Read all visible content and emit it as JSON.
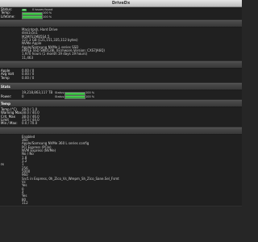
{
  "window": {
    "title": "DriveDx"
  },
  "summary": {
    "rows": [
      {
        "label": "Status:",
        "badge": "OK",
        "value": "0 issues found"
      },
      {
        "label": "Temp:",
        "bar_value": "100 %",
        "bar_fill": 1.0
      },
      {
        "label": "Lifetime:",
        "bar_value": "100 %",
        "bar_fill": 1.0
      }
    ]
  },
  "info": {
    "rows": [
      {
        "label": "",
        "value": "Macintosh, Hard Drive"
      },
      {
        "label": "",
        "value": "disk1s5s1"
      },
      {
        "label": "",
        "value": "M2MFS1MB5S4.5"
      },
      {
        "label": "",
        "value": "121.3 GB (121,151,335,112 bytes)"
      },
      {
        "label": "",
        "value": "NVMe Apple"
      },
      {
        "label": "",
        "value": "Apple/Samsung NVMe L series SSD"
      },
      {
        "label": "",
        "value": "APPLE SSD SM0128L (Firmware Version: CXS7JA6Q)"
      },
      {
        "label": "",
        "value": "1,970 hours (1 month 19 days 19 hours)"
      },
      {
        "label": "",
        "value": "11,463"
      }
    ]
  },
  "power": {
    "rows": [
      {
        "label": "Apple",
        "value": "0.00 / 0"
      },
      {
        "label": "Avg Volt",
        "value": "0.00 / 0"
      },
      {
        "label": "Temp",
        "value": "0.00 / 0"
      }
    ]
  },
  "stats": {
    "header": "Stats",
    "rows": [
      {
        "label": "",
        "value": "19,218,863,117 TB",
        "status": "Status:",
        "bar_value": "100 %",
        "bar_fill": 1.0
      },
      {
        "label": "Power:",
        "value": "0",
        "status": "Status:",
        "bar_value": "100 %",
        "bar_fill": 1.0
      }
    ]
  },
  "temps": {
    "header": "Temp",
    "rows": [
      {
        "label": "Temp (°C)",
        "value": "39.0 / 1.0"
      },
      {
        "label": "Warning Max",
        "value": "38.0 / 40.0"
      },
      {
        "label": "Crit. Max",
        "value": "38.0 / 46.0"
      },
      {
        "label": "Limit",
        "value": "13.0 / 44.0"
      },
      {
        "label": "Min / Max:",
        "value": "0.0 / 70.0"
      }
    ]
  },
  "details": {
    "rows": [
      {
        "label": "",
        "value": "Enabled"
      },
      {
        "label": "",
        "value": "360"
      },
      {
        "label": "",
        "value": "Apple/Samsung NVMe 360 L series config"
      },
      {
        "label": "",
        "value": "PCI Express (PCIe)"
      },
      {
        "label": "",
        "value": "NVM Express (NVMe)"
      },
      {
        "label": "",
        "value": "No / No"
      },
      {
        "label": "",
        "value": "1.8"
      },
      {
        "label": "",
        "value": "1.2"
      },
      {
        "label": "rx",
        "value": "1"
      },
      {
        "label": "",
        "value": "256"
      },
      {
        "label": "",
        "value": "5000"
      },
      {
        "label": "",
        "value": "960"
      },
      {
        "label": "",
        "value": "Sn/1 in Express, 0h_Zico_Vs_Wrepm_Sh_Zico_Sane.Sel_Fsmt"
      },
      {
        "label": "",
        "value": "Vc"
      },
      {
        "label": "",
        "value": "Yes"
      },
      {
        "label": "",
        "value": "0"
      },
      {
        "label": "",
        "value": "4"
      },
      {
        "label": "",
        "value": "Yes"
      },
      {
        "label": "",
        "value": "80"
      },
      {
        "label": "",
        "value": "112"
      }
    ]
  }
}
